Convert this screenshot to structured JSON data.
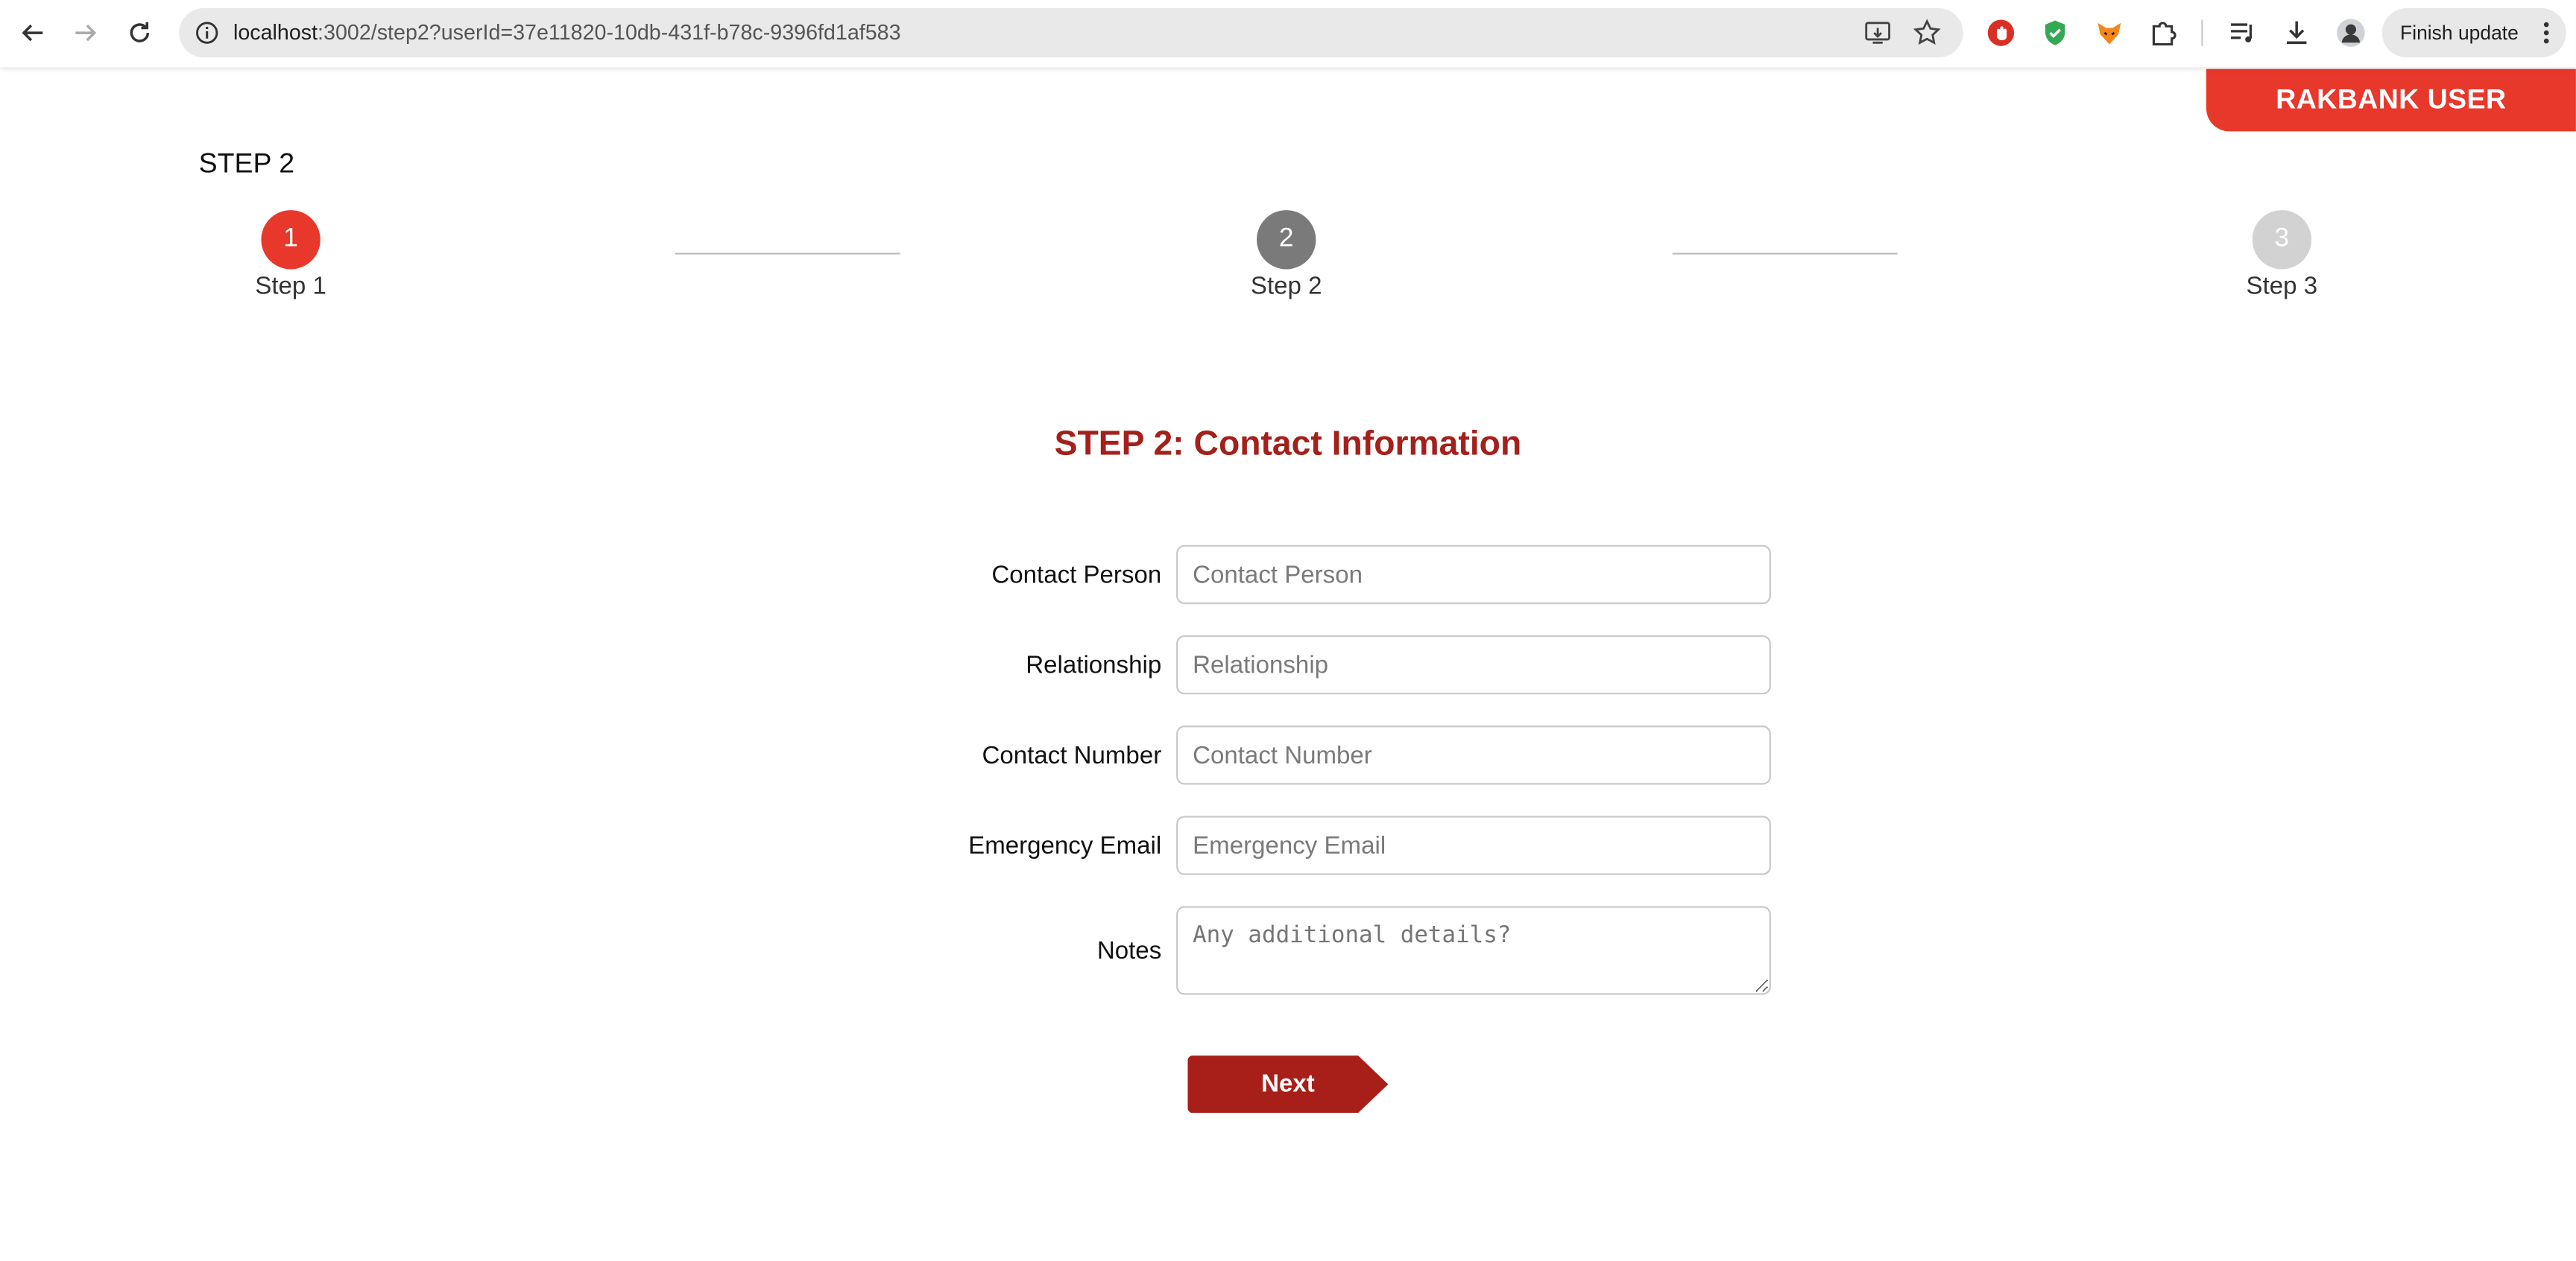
{
  "browser": {
    "url_host": "localhost",
    "url_rest": ":3002/step2?userId=37e11820-10db-431f-b78c-9396fd1af583",
    "finish_update": "Finish update"
  },
  "header": {
    "user_badge": "RAKBANK USER",
    "step_title": "STEP 2"
  },
  "stepper": [
    {
      "number": "1",
      "label": "Step 1",
      "color": "#e8382c"
    },
    {
      "number": "2",
      "label": "Step 2",
      "color": "#7a7a7a"
    },
    {
      "number": "3",
      "label": "Step 3",
      "color": "#d2d2d2"
    }
  ],
  "form": {
    "title": "STEP 2: Contact Information",
    "fields": [
      {
        "label": "Contact Person",
        "placeholder": "Contact Person",
        "value": ""
      },
      {
        "label": "Relationship",
        "placeholder": "Relationship",
        "value": ""
      },
      {
        "label": "Contact Number",
        "placeholder": "Contact Number",
        "value": ""
      },
      {
        "label": "Emergency Email",
        "placeholder": "Emergency Email",
        "value": ""
      },
      {
        "label": "Notes",
        "placeholder": "Any additional details?",
        "value": ""
      }
    ],
    "next_label": "Next"
  },
  "colors": {
    "accent": "#e8382c",
    "title_red": "#a4201a",
    "button_red": "#a81f19"
  }
}
